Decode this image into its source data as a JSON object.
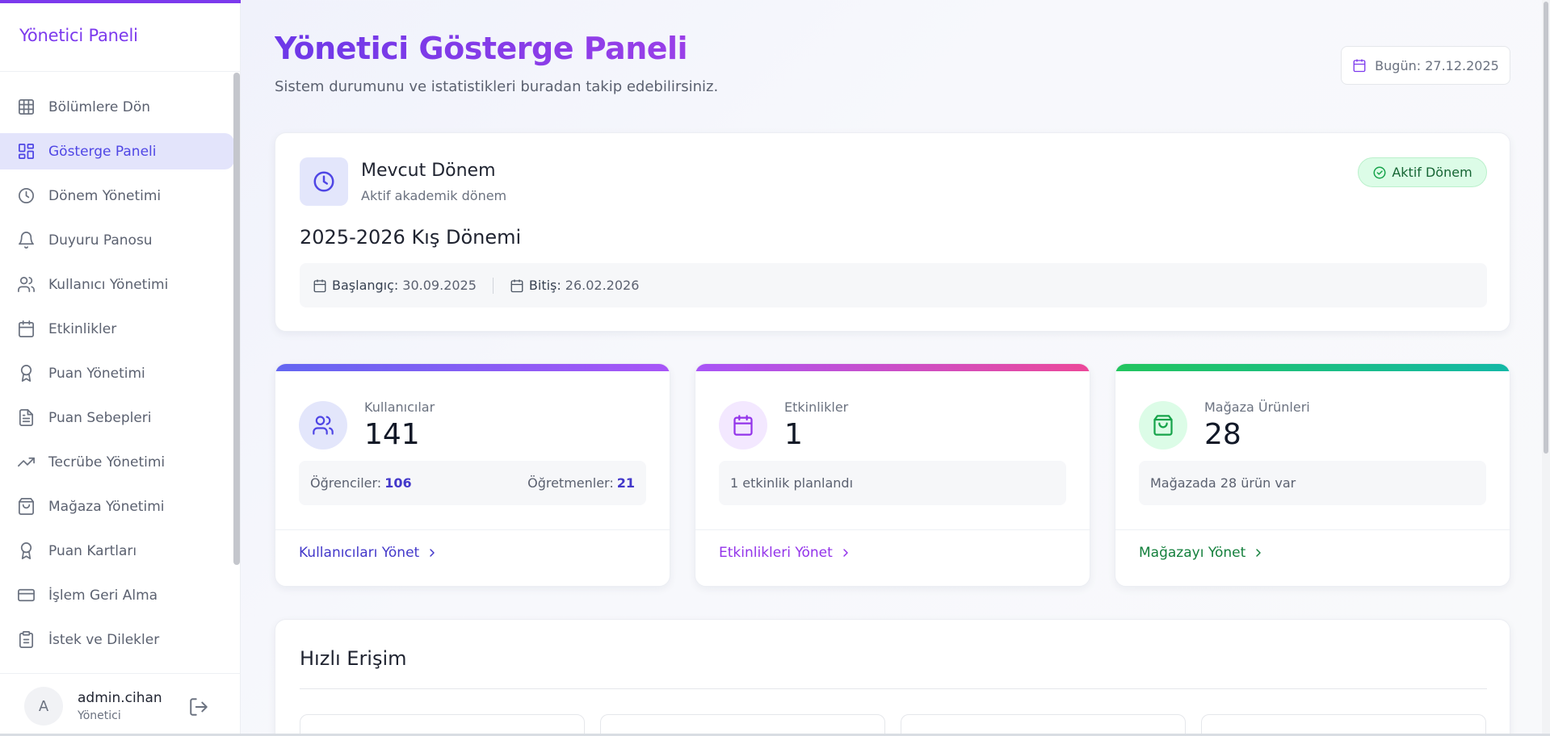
{
  "sidebar": {
    "brand": "Yönetici Paneli",
    "items": [
      {
        "label": "Bölümlere Dön",
        "icon": "grid-icon",
        "active": false
      },
      {
        "label": "Gösterge Paneli",
        "icon": "dashboard-icon",
        "active": true
      },
      {
        "label": "Dönem Yönetimi",
        "icon": "clock-icon",
        "active": false
      },
      {
        "label": "Duyuru Panosu",
        "icon": "bell-icon",
        "active": false
      },
      {
        "label": "Kullanıcı Yönetimi",
        "icon": "users-icon",
        "active": false
      },
      {
        "label": "Etkinlikler",
        "icon": "calendar-icon",
        "active": false
      },
      {
        "label": "Puan Yönetimi",
        "icon": "award-icon",
        "active": false
      },
      {
        "label": "Puan Sebepleri",
        "icon": "file-text-icon",
        "active": false
      },
      {
        "label": "Tecrübe Yönetimi",
        "icon": "trending-up-icon",
        "active": false
      },
      {
        "label": "Mağaza Yönetimi",
        "icon": "shopping-bag-icon",
        "active": false
      },
      {
        "label": "Puan Kartları",
        "icon": "award-icon",
        "active": false
      },
      {
        "label": "İşlem Geri Alma",
        "icon": "credit-card-icon",
        "active": false
      },
      {
        "label": "İstek ve Dilekler",
        "icon": "clipboard-icon",
        "active": false
      }
    ],
    "user": {
      "initial": "A",
      "name": "admin.cihan",
      "role": "Yönetici"
    }
  },
  "header": {
    "title": "Yönetici Gösterge Paneli",
    "subtitle": "Sistem durumunu ve istatistikleri buradan takip edebilirsiniz.",
    "today": "Bugün: 27.12.2025"
  },
  "period": {
    "title": "Mevcut Dönem",
    "subtitle": "Aktif akademik dönem",
    "badge": "Aktif Dönem",
    "name": "2025-2026 Kış Dönemi",
    "start_label": "Başlangıç:",
    "start_value": "30.09.2025",
    "end_label": "Bitiş:",
    "end_value": "26.02.2026"
  },
  "stats": [
    {
      "label": "Kullanıcılar",
      "value": "141",
      "students_label": "Öğrenciler:",
      "students_value": "106",
      "teachers_label": "Öğretmenler:",
      "teachers_value": "21",
      "link": "Kullanıcıları Yönet"
    },
    {
      "label": "Etkinlikler",
      "value": "1",
      "info": "1 etkinlik planlandı",
      "link": "Etkinlikleri Yönet"
    },
    {
      "label": "Mağaza Ürünleri",
      "value": "28",
      "info": "Mağazada 28 ürün var",
      "link": "Mağazayı Yönet"
    }
  ],
  "quick": {
    "title": "Hızlı Erişim"
  },
  "colors": {
    "accent": "#7c3aed",
    "indigo": "#4f46e5",
    "green": "#16a34a",
    "users_link": "#4338ca",
    "events_link": "#9333ea",
    "shop_link": "#15803d"
  }
}
